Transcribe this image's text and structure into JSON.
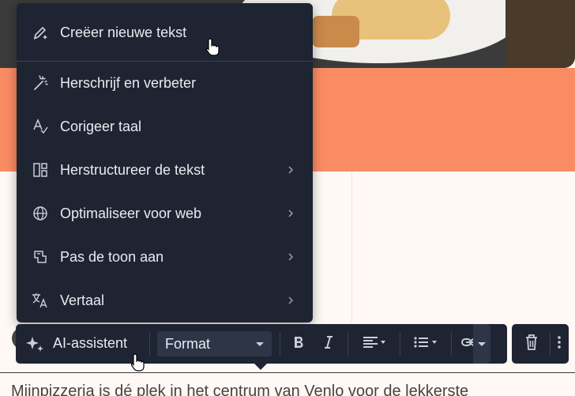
{
  "menu": {
    "items": [
      {
        "label": "Creëer nieuwe tekst",
        "icon": "pen-sparkle-icon",
        "submenu": false
      },
      {
        "label": "Herschrijf en verbeter",
        "icon": "magic-wand-icon",
        "submenu": false
      },
      {
        "label": "Corigeer taal",
        "icon": "spell-check-icon",
        "submenu": false
      },
      {
        "label": "Herstructureer de tekst",
        "icon": "layout-icon",
        "submenu": true
      },
      {
        "label": "Optimaliseer voor web",
        "icon": "globe-icon",
        "submenu": true
      },
      {
        "label": "Pas de toon aan",
        "icon": "tone-icon",
        "submenu": true
      },
      {
        "label": "Vertaal",
        "icon": "translate-icon",
        "submenu": true
      }
    ]
  },
  "toolbar": {
    "ai_label": "AI-assistent",
    "format_value": "Format"
  },
  "content": {
    "body_text": "Mijnpizzeria is dé plek in het centrum van Venlo voor de lekkerste"
  },
  "colors": {
    "menu_bg": "#1e2432",
    "orange": "#fa8c63",
    "page_bg": "#fff8f5"
  }
}
